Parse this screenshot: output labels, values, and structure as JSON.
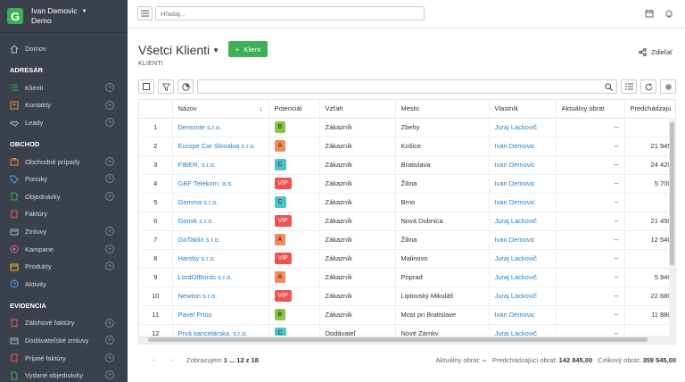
{
  "sidebar": {
    "logo": "G",
    "user_name": "Ivan Demovic",
    "user_org": "Demo",
    "home": "Domov",
    "sections": [
      {
        "title": "ADRESÁR",
        "items": [
          {
            "label": "Klienti",
            "icon": "list-icon",
            "plus": true
          },
          {
            "label": "Kontakty",
            "icon": "contacts-icon",
            "plus": true
          },
          {
            "label": "Leady",
            "icon": "handshake-icon",
            "plus": true
          }
        ]
      },
      {
        "title": "OBCHOD",
        "items": [
          {
            "label": "Obchodné prípady",
            "icon": "briefcase-icon",
            "plus": true
          },
          {
            "label": "Ponuky",
            "icon": "tag-icon",
            "plus": true
          },
          {
            "label": "Objednávky",
            "icon": "document-icon",
            "plus": true
          },
          {
            "label": "Faktúry",
            "icon": "invoice-icon",
            "plus": false
          },
          {
            "label": "Zmluvy",
            "icon": "contract-icon",
            "plus": true
          },
          {
            "label": "Kampane",
            "icon": "target-icon",
            "plus": true
          },
          {
            "label": "Produkty",
            "icon": "box-icon",
            "plus": true
          },
          {
            "label": "Aktivity",
            "icon": "clock-icon",
            "plus": false
          }
        ]
      },
      {
        "title": "EVIDENCIA",
        "items": [
          {
            "label": "Zálohové faktúry",
            "icon": "invoice-icon",
            "plus": true
          },
          {
            "label": "Dodávateľské zmluvy",
            "icon": "contract-icon",
            "plus": true
          },
          {
            "label": "Prijaté faktúry",
            "icon": "invoice-icon",
            "plus": true
          },
          {
            "label": "Vydané objednávky",
            "icon": "document-icon",
            "plus": true
          }
        ]
      }
    ]
  },
  "topbar": {
    "search_placeholder": "Hľadaj..."
  },
  "page": {
    "title": "Všetci Klienti",
    "add_label": "Klient",
    "subtitle": "KLIENTI",
    "share_label": "Zdieľať"
  },
  "table": {
    "columns": [
      "",
      "Názov",
      "Potenciál",
      "Vzťah",
      "Mesto",
      "Vlastník",
      "Aktuálny obrat",
      "Predchádzajú"
    ],
    "rows": [
      {
        "n": "1",
        "name": "Demonte s.r.o.",
        "pot": "B",
        "rel": "Zákazník",
        "city": "Zbehy",
        "owner": "Juraj Lackovič",
        "cur": "--",
        "prev": ""
      },
      {
        "n": "2",
        "name": "Europe Car Slovakia s.r.o.",
        "pot": "A",
        "rel": "Zákazník",
        "city": "Košice",
        "owner": "Ivan Demovic",
        "cur": "--",
        "prev": "21 945"
      },
      {
        "n": "3",
        "name": "FIBER, s.r.o.",
        "pot": "C",
        "rel": "Zákazník",
        "city": "Bratislava",
        "owner": "Ivan Demovic",
        "cur": "--",
        "prev": "24 420"
      },
      {
        "n": "4",
        "name": "GBF Telekom, a.s.",
        "pot": "VIP",
        "rel": "Zákazník",
        "city": "Žilina",
        "owner": "Ivan Demovic",
        "cur": "--",
        "prev": "5 700"
      },
      {
        "n": "5",
        "name": "Gemma s.r.o.",
        "pot": "C",
        "rel": "Zákazník",
        "city": "Brno",
        "owner": "Ivan Demovic",
        "cur": "--",
        "prev": ""
      },
      {
        "n": "6",
        "name": "Gomik s.r.o.",
        "pot": "VIP",
        "rel": "Zákazník",
        "city": "Nová Dubnica",
        "owner": "Juraj Lackovič",
        "cur": "--",
        "prev": "21 450"
      },
      {
        "n": "7",
        "name": "GoTaklin s.r.o.",
        "pot": "A",
        "rel": "Zákazník",
        "city": "Žilina",
        "owner": "Ivan Demovic",
        "cur": "--",
        "prev": "12 540"
      },
      {
        "n": "8",
        "name": "Harsby s.r.o.",
        "pot": "VIP",
        "rel": "Zákazník",
        "city": "Malinovo",
        "owner": "Juraj Lackovič",
        "cur": "--",
        "prev": ""
      },
      {
        "n": "9",
        "name": "LordOfBords s.r.o.",
        "pot": "A",
        "rel": "Zákazník",
        "city": "Poprad",
        "owner": "Juraj Lackovič",
        "cur": "--",
        "prev": "5 940"
      },
      {
        "n": "10",
        "name": "Newton s.r.o.",
        "pot": "VIP",
        "rel": "Zákazník",
        "city": "Liptovský Mikuláš",
        "owner": "Juraj Lackovič",
        "cur": "--",
        "prev": "22 680"
      },
      {
        "n": "11",
        "name": "Pavel Frtús",
        "pot": "B",
        "rel": "Zákazník",
        "city": "Most pri Bratislave",
        "owner": "Ivan Demovic",
        "cur": "--",
        "prev": "11 880"
      },
      {
        "n": "12",
        "name": "Prvá kancelárska, s.r.o.",
        "pot": "C",
        "rel": "Dodávateľ",
        "city": "Nové Zámky",
        "owner": "Juraj Lackovič",
        "cur": "--",
        "prev": ""
      }
    ]
  },
  "footer": {
    "showing_label": "Zobrazujem",
    "showing_value": "1 ... 12 z 18",
    "cur_label": "Aktuálny obrat:",
    "cur_value": "--",
    "prev_label": "Predchádzajúci obrat:",
    "prev_value": "142 845,00",
    "total_label": "Celkový obrat:",
    "total_value": "359 545,00"
  },
  "colors": {
    "accent": "#3cb058",
    "sidebar": "#3a414c",
    "link": "#2b7fc4"
  }
}
